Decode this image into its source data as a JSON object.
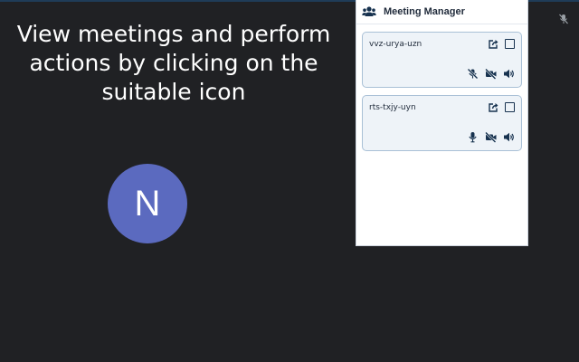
{
  "caption": "View meetings and perform actions by clicking on the suitable icon",
  "avatar": {
    "initial": "N",
    "color": "#5b6abf"
  },
  "panel": {
    "title": "Meeting Manager",
    "header_icon": "users-icon"
  },
  "meetings": [
    {
      "code": "vvz-urya-uzn",
      "actions": [
        "share-icon",
        "checkbox"
      ],
      "controls": [
        "microphone-muted-icon",
        "camera-off-icon",
        "speaker-icon"
      ]
    },
    {
      "code": "rts-txjy-uyn",
      "actions": [
        "share-icon",
        "checkbox"
      ],
      "controls": [
        "microphone-icon",
        "camera-off-icon",
        "speaker-icon"
      ]
    }
  ],
  "colors": {
    "background": "#202124",
    "icon": "#17324f",
    "card_bg": "#eef3f8",
    "card_border": "#a9c0d6"
  }
}
